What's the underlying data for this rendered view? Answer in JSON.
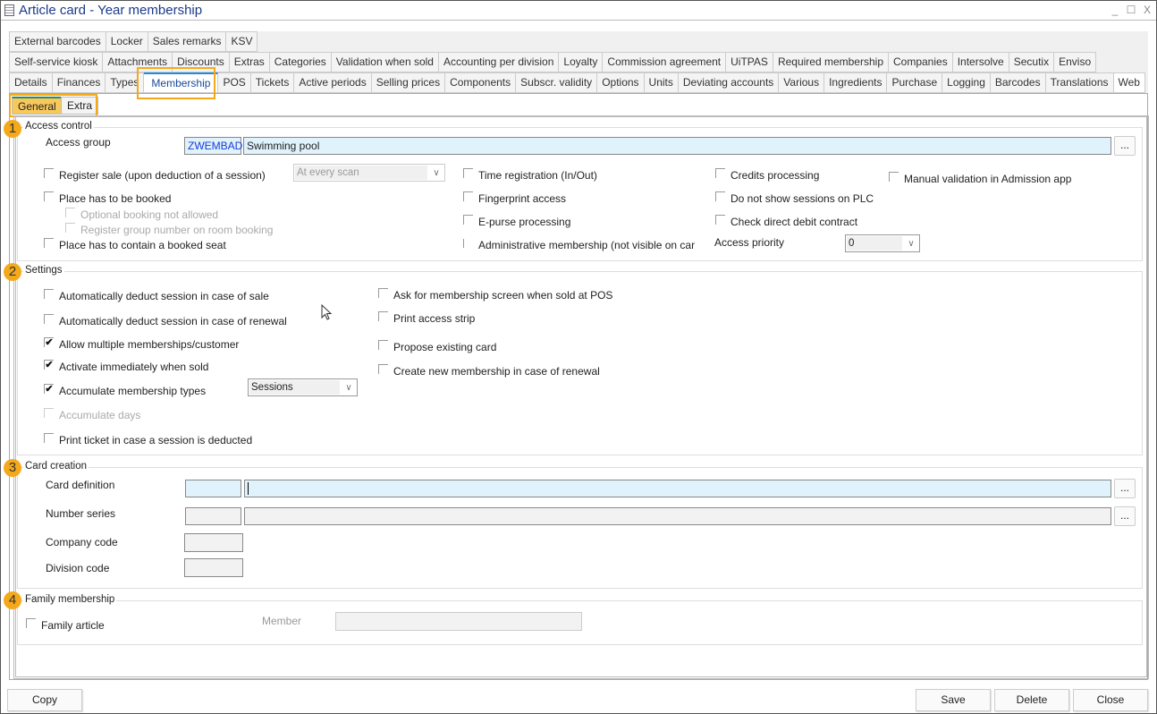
{
  "window": {
    "title": "Article card - Year membership",
    "minimize": "_",
    "maximize": "☐",
    "close": "X"
  },
  "tabs": {
    "row1": [
      "External barcodes",
      "Locker",
      "Sales remarks",
      "KSV"
    ],
    "row2": [
      "Self-service kiosk",
      "Attachments",
      "Discounts",
      "Extras",
      "Categories",
      "Validation when sold",
      "Accounting per division",
      "Loyalty",
      "Commission agreement",
      "UiTPAS",
      "Required membership",
      "Companies",
      "Intersolve",
      "Secutix",
      "Enviso"
    ],
    "row3": [
      "Details",
      "Finances",
      "Types",
      "Membership",
      "POS",
      "Tickets",
      "Active periods",
      "Selling prices",
      "Components",
      "Subscr. validity",
      "Options",
      "Units",
      "Deviating accounts",
      "Various",
      "Ingredients",
      "Purchase",
      "Logging",
      "Barcodes",
      "Translations",
      "Web"
    ],
    "active": "Membership"
  },
  "subtabs": {
    "general": "General",
    "extra": "Extra",
    "active": "General"
  },
  "highlight_color": "#f4a91c",
  "access_control": {
    "badge": "1",
    "title": "Access control",
    "access_group_label": "Access group",
    "access_group_code": "ZWEMBAD",
    "access_group_name": "Swimming pool",
    "browse": "...",
    "register_sale": {
      "label": "Register sale (upon deduction of a session)",
      "checked": false,
      "option": "At every scan"
    },
    "place_booked": {
      "label": "Place has to be booked",
      "checked": false
    },
    "optional_booking": {
      "label": "Optional booking not allowed",
      "checked": false
    },
    "register_group": {
      "label": "Register group number on room booking",
      "checked": false
    },
    "booked_seat": {
      "label": "Place has to contain a booked seat",
      "checked": false
    },
    "time_registration": {
      "label": "Time registration (In/Out)",
      "checked": false
    },
    "fingerprint": {
      "label": "Fingerprint access",
      "checked": false
    },
    "epurse": {
      "label": "E-purse processing",
      "checked": false
    },
    "administrative": {
      "label": "Administrative membership (not visible on car",
      "checked": false
    },
    "credits": {
      "label": "Credits processing",
      "checked": false
    },
    "no_sessions_plc": {
      "label": "Do not show sessions on PLC",
      "checked": false
    },
    "direct_debit": {
      "label": "Check direct debit contract",
      "checked": false
    },
    "manual_validation": {
      "label": "Manual validation in Admission app",
      "checked": false
    },
    "access_priority_label": "Access priority",
    "access_priority": "0"
  },
  "settings": {
    "badge": "2",
    "title": "Settings",
    "auto_deduct_sale": {
      "label": "Automatically deduct session in case of sale",
      "checked": false
    },
    "auto_deduct_renewal": {
      "label": "Automatically deduct session in case of renewal",
      "checked": false
    },
    "allow_multiple": {
      "label": "Allow multiple memberships/customer",
      "checked": true
    },
    "activate_immediately": {
      "label": "Activate immediately when sold",
      "checked": true
    },
    "accumulate_types": {
      "label": "Accumulate membership types",
      "checked": true,
      "option": "Sessions"
    },
    "accumulate_days": {
      "label": "Accumulate days",
      "checked": false
    },
    "print_ticket": {
      "label": "Print ticket in case a session is deducted",
      "checked": false
    },
    "ask_screen": {
      "label": "Ask for membership screen when sold at POS",
      "checked": false
    },
    "print_strip": {
      "label": "Print access strip",
      "checked": false
    },
    "propose_card": {
      "label": "Propose existing card",
      "checked": false
    },
    "create_new": {
      "label": "Create new membership in case of renewal",
      "checked": false
    }
  },
  "card_creation": {
    "badge": "3",
    "title": "Card creation",
    "card_definition": "Card definition",
    "number_series": "Number series",
    "company_code": "Company code",
    "division_code": "Division code",
    "browse": "..."
  },
  "family": {
    "badge": "4",
    "title": "Family membership",
    "family_article": {
      "label": "Family article",
      "checked": false
    },
    "member_label": "Member"
  },
  "footer": {
    "copy": "Copy",
    "save": "Save",
    "delete": "Delete",
    "close": "Close"
  }
}
